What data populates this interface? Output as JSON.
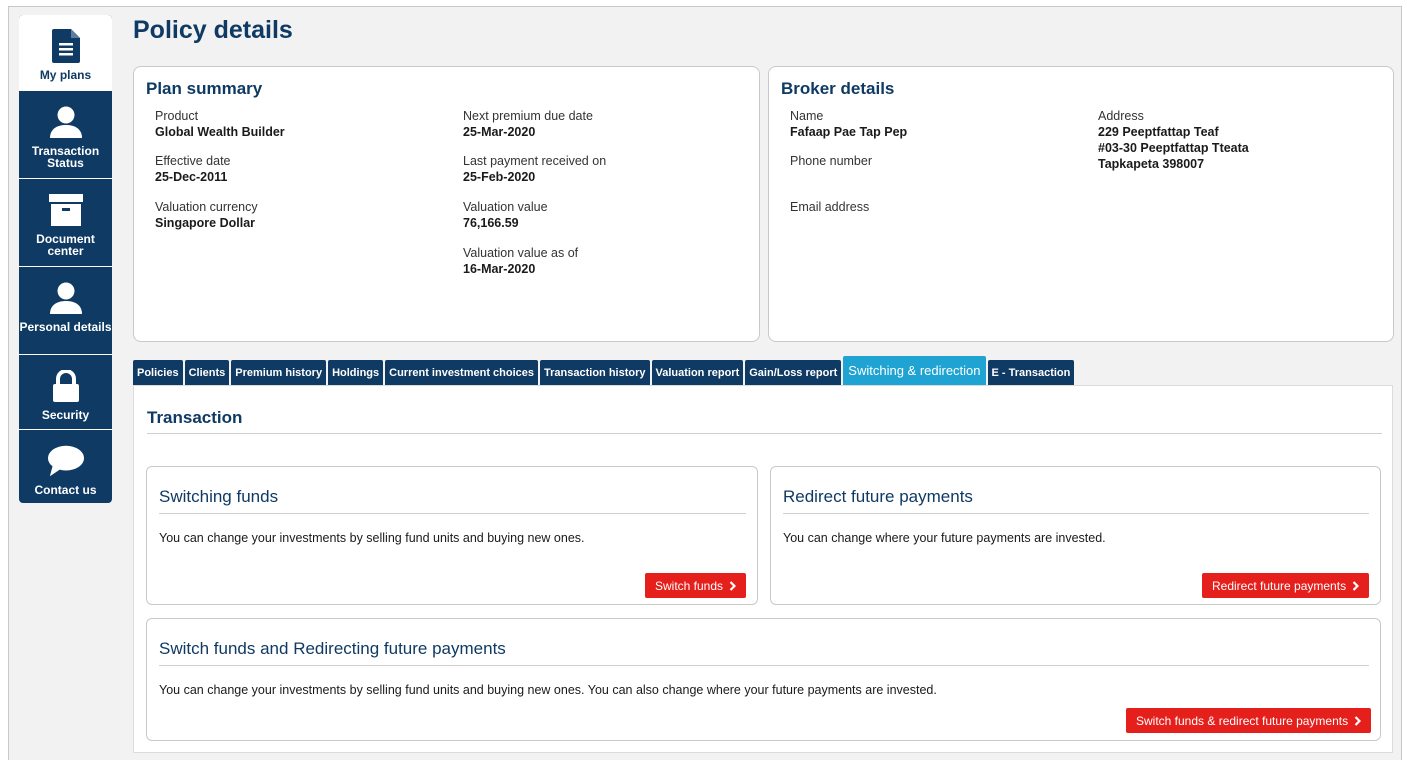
{
  "sidebar": {
    "items": [
      {
        "label": "My plans",
        "icon": "document-icon",
        "active": true
      },
      {
        "label": "Transaction Status",
        "icon": "person-icon"
      },
      {
        "label": "Document center",
        "icon": "archive-box-icon"
      },
      {
        "label": "Personal details",
        "icon": "person-icon"
      },
      {
        "label": "Security",
        "icon": "lock-icon"
      },
      {
        "label": "Contact us",
        "icon": "chat-bubble-icon"
      }
    ]
  },
  "page": {
    "title": "Policy details"
  },
  "plan_summary": {
    "title": "Plan summary",
    "product_label": "Product",
    "product_value": "Global Wealth Builder",
    "effective_label": "Effective date",
    "effective_value": "25-Dec-2011",
    "currency_label": "Valuation currency",
    "currency_value": "Singapore Dollar",
    "next_premium_label": "Next premium due date",
    "next_premium_value": "25-Mar-2020",
    "last_payment_label": "Last payment received on",
    "last_payment_value": "25-Feb-2020",
    "valuation_label": "Valuation value",
    "valuation_value": "76,166.59",
    "valuation_asof_label": "Valuation value as of",
    "valuation_asof_value": "16-Mar-2020"
  },
  "broker": {
    "title": "Broker details",
    "name_label": "Name",
    "name_value": "Fafaap Pae Tap Pep",
    "phone_label": "Phone number",
    "email_label": "Email address",
    "address_label": "Address",
    "address_line1": "229 Peeptfattap Teaf",
    "address_line2": "#03-30 Peeptfattap Tteata",
    "address_line3": "Tapkapeta 398007"
  },
  "tabs": [
    "Policies",
    "Clients",
    "Premium history",
    "Holdings",
    "Current investment choices",
    "Transaction history",
    "Valuation report",
    "Gain/Loss report",
    "Switching & redirection",
    "E - Transaction"
  ],
  "active_tab": "Switching & redirection",
  "transaction": {
    "title": "Transaction",
    "switching": {
      "title": "Switching funds",
      "text": "You can change your investments by selling fund units and buying new ones.",
      "button": "Switch funds"
    },
    "redirect": {
      "title": "Redirect future payments",
      "text": "You can change where your future payments are invested.",
      "button": "Redirect future payments"
    },
    "combined": {
      "title": "Switch funds and Redirecting future payments",
      "text": "You can change your investments by selling fund units and buying new ones. You can also change where your future payments are invested.",
      "button": "Switch funds & redirect future payments"
    }
  },
  "colors": {
    "navy": "#0f3a63",
    "accent_tab": "#1fa3d3",
    "button_red": "#e5201c"
  }
}
